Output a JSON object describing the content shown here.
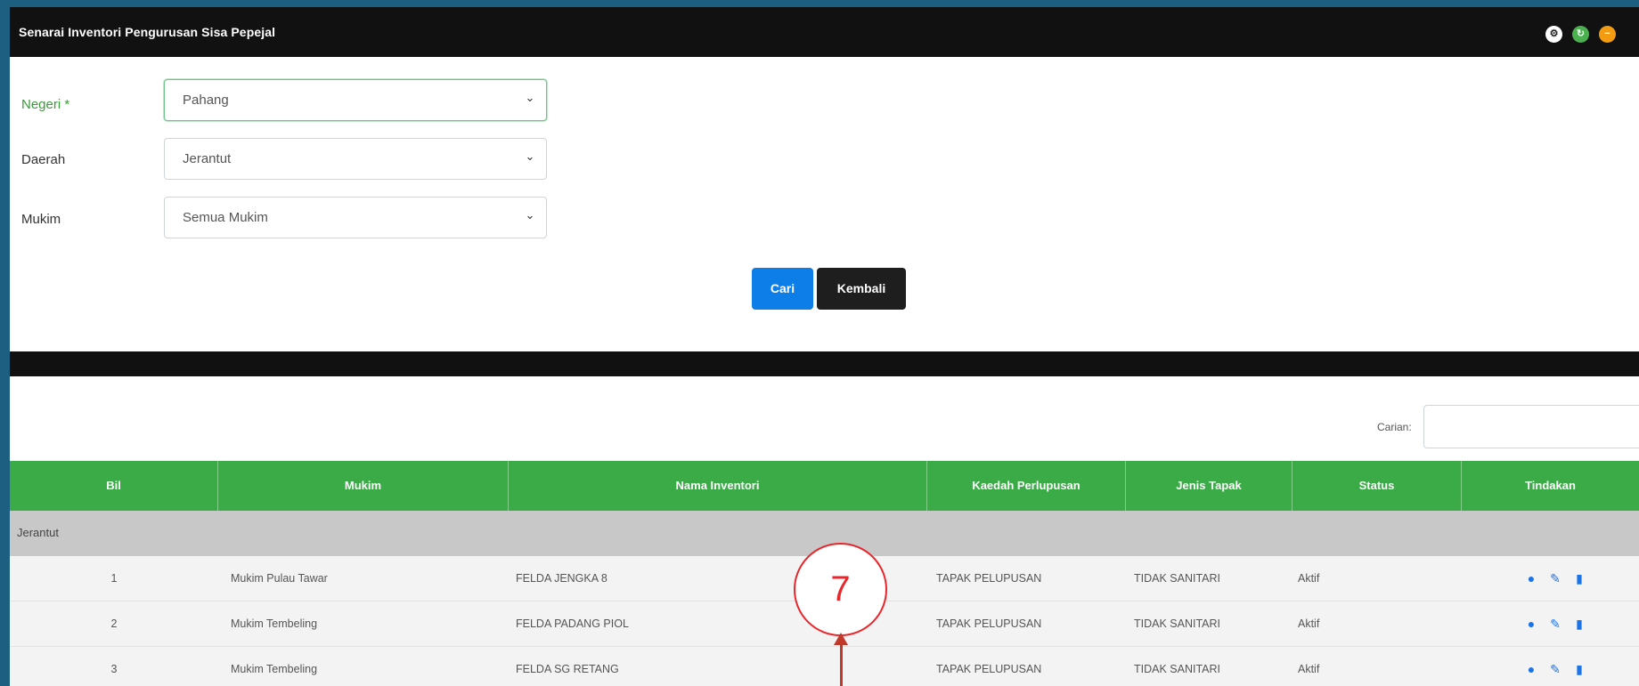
{
  "header": {
    "title": "Senarai Inventori Pengurusan Sisa Pepejal",
    "icons": [
      "gear-icon",
      "refresh-icon",
      "minimize-icon"
    ]
  },
  "form": {
    "negeri": {
      "label": "Negeri *",
      "value": "Pahang"
    },
    "daerah": {
      "label": "Daerah",
      "value": "Jerantut"
    },
    "mukim": {
      "label": "Mukim",
      "value": "Semua Mukim"
    }
  },
  "buttons": {
    "search": "Cari",
    "back": "Kembali"
  },
  "search": {
    "label": "Carian:",
    "value": ""
  },
  "table": {
    "columns": [
      "Bil",
      "Mukim",
      "Nama Inventori",
      "Kaedah Perlupusan",
      "Jenis Tapak",
      "Status",
      "Tindakan"
    ],
    "group": "Jerantut",
    "rows": [
      {
        "bil": "1",
        "mukim": "Mukim Pulau Tawar",
        "nama": "FELDA JENGKA 8",
        "kaedah": "TAPAK PELUPUSAN",
        "jenis": "TIDAK SANITARI",
        "status": "Aktif"
      },
      {
        "bil": "2",
        "mukim": "Mukim Tembeling",
        "nama": "FELDA PADANG PIOL",
        "kaedah": "TAPAK PELUPUSAN",
        "jenis": "TIDAK SANITARI",
        "status": "Aktif"
      },
      {
        "bil": "3",
        "mukim": "Mukim Tembeling",
        "nama": "FELDA SG RETANG",
        "kaedah": "TAPAK PELUPUSAN",
        "jenis": "TIDAK SANITARI",
        "status": "Aktif"
      }
    ],
    "action_icons": [
      "view-icon",
      "edit-icon",
      "delete-icon"
    ]
  },
  "annotation": {
    "label": "7"
  },
  "colors": {
    "table_header": "#3aab47",
    "primary": "#0d7ee8",
    "dark": "#111111",
    "annotation": "#e8262b"
  }
}
